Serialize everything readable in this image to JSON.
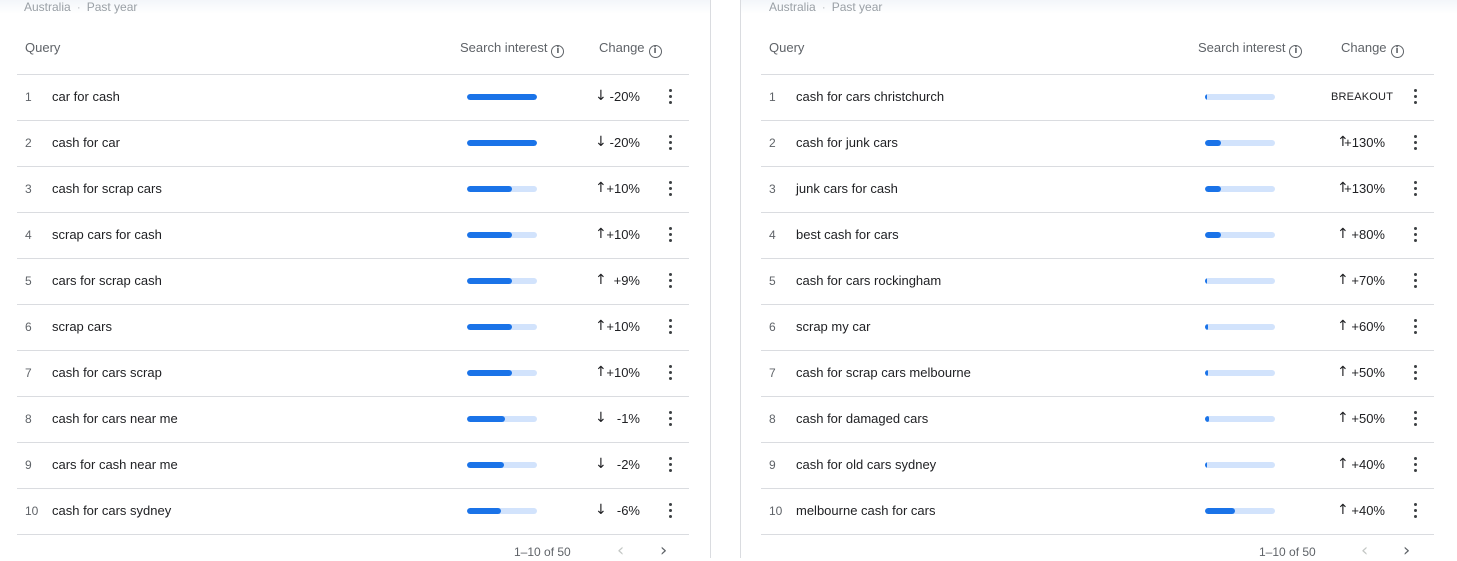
{
  "panels": [
    {
      "subtitle": {
        "region": "Australia",
        "separator": "·",
        "period": "Past year"
      },
      "columns": {
        "query": "Query",
        "search_interest": "Search interest",
        "change": "Change"
      },
      "rows": [
        {
          "rank": "1",
          "query": "car for cash",
          "interest": 1.0,
          "direction": "down",
          "change": "-20%"
        },
        {
          "rank": "2",
          "query": "cash for car",
          "interest": 1.0,
          "direction": "down",
          "change": "-20%"
        },
        {
          "rank": "3",
          "query": "cash for scrap cars",
          "interest": 0.64,
          "direction": "up",
          "change": "+10%"
        },
        {
          "rank": "4",
          "query": "scrap cars for cash",
          "interest": 0.64,
          "direction": "up",
          "change": "+10%"
        },
        {
          "rank": "5",
          "query": "cars for scrap cash",
          "interest": 0.64,
          "direction": "up",
          "change": "+9%"
        },
        {
          "rank": "6",
          "query": "scrap cars",
          "interest": 0.64,
          "direction": "up",
          "change": "+10%"
        },
        {
          "rank": "7",
          "query": "cash for cars scrap",
          "interest": 0.64,
          "direction": "up",
          "change": "+10%"
        },
        {
          "rank": "8",
          "query": "cash for cars near me",
          "interest": 0.54,
          "direction": "down",
          "change": "-1%"
        },
        {
          "rank": "9",
          "query": "cars for cash near me",
          "interest": 0.53,
          "direction": "down",
          "change": "-2%"
        },
        {
          "rank": "10",
          "query": "cash for cars sydney",
          "interest": 0.49,
          "direction": "down",
          "change": "-6%"
        }
      ],
      "pagination": {
        "label": "1–10 of 50",
        "prev_icon": "‹",
        "next_icon": "›"
      }
    },
    {
      "subtitle": {
        "region": "Australia",
        "separator": "·",
        "period": "Past year"
      },
      "columns": {
        "query": "Query",
        "search_interest": "Search interest",
        "change": "Change"
      },
      "rows": [
        {
          "rank": "1",
          "query": "cash for cars christchurch",
          "interest": 0.02,
          "direction": "none",
          "change": "BREAKOUT"
        },
        {
          "rank": "2",
          "query": "cash for junk cars",
          "interest": 0.23,
          "direction": "up",
          "change": "+130%"
        },
        {
          "rank": "3",
          "query": "junk cars for cash",
          "interest": 0.23,
          "direction": "up",
          "change": "+130%"
        },
        {
          "rank": "4",
          "query": "best cash for cars",
          "interest": 0.23,
          "direction": "up",
          "change": "+80%"
        },
        {
          "rank": "5",
          "query": "cash for cars rockingham",
          "interest": 0.03,
          "direction": "up",
          "change": "+70%"
        },
        {
          "rank": "6",
          "query": "scrap my car",
          "interest": 0.04,
          "direction": "up",
          "change": "+60%"
        },
        {
          "rank": "7",
          "query": "cash for scrap cars melbourne",
          "interest": 0.04,
          "direction": "up",
          "change": "+50%"
        },
        {
          "rank": "8",
          "query": "cash for damaged cars",
          "interest": 0.06,
          "direction": "up",
          "change": "+50%"
        },
        {
          "rank": "9",
          "query": "cash for old cars sydney",
          "interest": 0.03,
          "direction": "up",
          "change": "+40%"
        },
        {
          "rank": "10",
          "query": "melbourne cash for cars",
          "interest": 0.43,
          "direction": "up",
          "change": "+40%"
        }
      ],
      "pagination": {
        "label": "1–10 of 50",
        "prev_icon": "‹",
        "next_icon": "›"
      }
    }
  ],
  "icons": {
    "info": "i",
    "arrow_up": "↑",
    "arrow_down": "↓",
    "more": "more-vert-icon"
  },
  "colors": {
    "bar_fill": "#1a73e8",
    "bar_track": "#d2e3fc",
    "divider": "#dadce0",
    "muted_text": "#5f6368"
  }
}
